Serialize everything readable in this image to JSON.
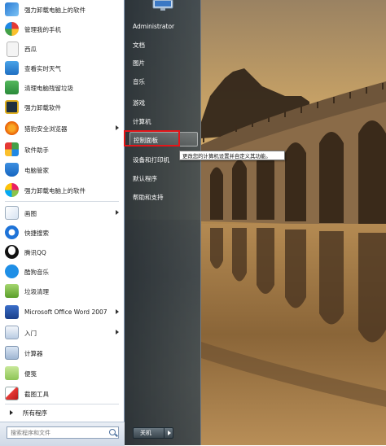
{
  "left_menu": {
    "items": [
      {
        "label": "强力卸载电脑上的软件",
        "icon": "uninstall-icon",
        "arrow": false
      },
      {
        "label": "管理我的手机",
        "icon": "phone-manager-icon",
        "arrow": false
      },
      {
        "label": "西瓜",
        "icon": "document-icon",
        "arrow": false
      },
      {
        "label": "查看实时天气",
        "icon": "weather-icon",
        "arrow": false
      },
      {
        "label": "清理电脑残留垃圾",
        "icon": "cleanup-icon",
        "arrow": false
      },
      {
        "label": "强力卸载软件",
        "icon": "uninstall-shield-icon",
        "arrow": false
      },
      {
        "label": "猎豹安全浏览器",
        "icon": "cheetah-browser-icon",
        "arrow": true
      },
      {
        "label": "软件助手",
        "icon": "software-helper-icon",
        "arrow": false
      },
      {
        "label": "电脑管家",
        "icon": "pc-manager-icon",
        "arrow": false
      },
      {
        "label": "强力卸载电脑上的软件",
        "icon": "uninstall-icon",
        "arrow": false
      },
      {
        "label": "画图",
        "icon": "paint-icon",
        "arrow": true
      },
      {
        "label": "快捷搜索",
        "icon": "quick-search-icon",
        "arrow": false
      },
      {
        "label": "腾讯QQ",
        "icon": "qq-icon",
        "arrow": false
      },
      {
        "label": "酷狗音乐",
        "icon": "kugou-icon",
        "arrow": false
      },
      {
        "label": "垃圾清理",
        "icon": "trash-cleanup-icon",
        "arrow": false
      },
      {
        "label": "Microsoft Office Word 2007",
        "icon": "word-icon",
        "arrow": true
      },
      {
        "label": "入门",
        "icon": "getting-started-icon",
        "arrow": true
      },
      {
        "label": "计算器",
        "icon": "calculator-icon",
        "arrow": false
      },
      {
        "label": "便笺",
        "icon": "sticky-notes-icon",
        "arrow": false
      },
      {
        "label": "截图工具",
        "icon": "snipping-tool-icon",
        "arrow": false
      }
    ],
    "all_programs": "所有程序",
    "search_placeholder": "搜索程序和文件"
  },
  "right_menu": {
    "items": [
      {
        "label": "Administrator"
      },
      {
        "label": "文档"
      },
      {
        "label": "图片"
      },
      {
        "label": "音乐"
      },
      {
        "label": "游戏"
      },
      {
        "label": "计算机"
      },
      {
        "label": "控制面板"
      },
      {
        "label": "设备和打印机"
      },
      {
        "label": "默认程序"
      },
      {
        "label": "帮助和支持"
      }
    ],
    "highlighted_index": 6,
    "tooltip": "更改您的计算机设置并自定义其功能。",
    "shutdown_label": "关机"
  },
  "colors": {
    "highlight_border": "#e3161a",
    "right_pane": "#2c3a44",
    "left_pane": "#ffffff"
  }
}
